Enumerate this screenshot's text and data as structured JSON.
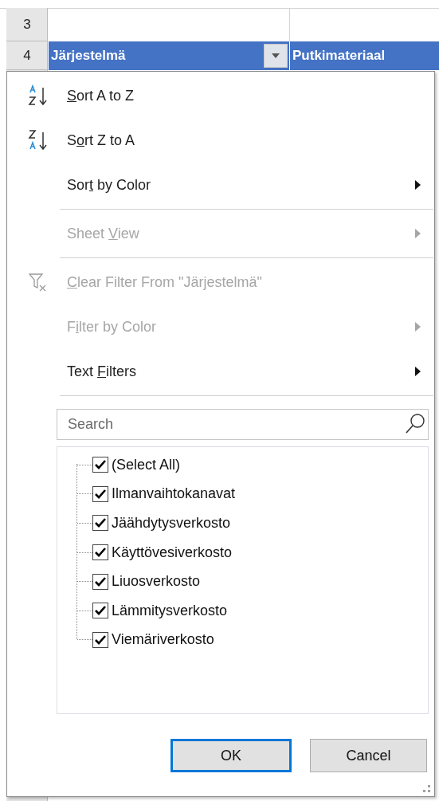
{
  "sheet": {
    "rows": [
      {
        "number": "3",
        "cells": []
      },
      {
        "number": "4",
        "cells": [
          {
            "text": "Järjestelmä",
            "filter_button": true
          },
          {
            "text": "Putkimateriaal",
            "filter_button": false
          }
        ]
      }
    ]
  },
  "menu": {
    "items": [
      {
        "kind": "sort_az",
        "label": {
          "key": "S",
          "after": "ort A to Z"
        },
        "disabled": false,
        "submenu": false,
        "divider_after": false
      },
      {
        "kind": "sort_za",
        "label": {
          "before": "S",
          "key": "o",
          "after": "rt Z to A"
        },
        "disabled": false,
        "submenu": false,
        "divider_after": false
      },
      {
        "kind": "plain",
        "label": {
          "before": "Sor",
          "key": "t",
          "after": " by Color"
        },
        "disabled": false,
        "submenu": true,
        "divider_after": true
      },
      {
        "kind": "plain",
        "label": {
          "before": "Sheet ",
          "key": "V",
          "after": "iew"
        },
        "disabled": true,
        "submenu": true,
        "divider_after": true
      },
      {
        "kind": "clear_filter",
        "label": {
          "key": "C",
          "after": "lear Filter From \"Järjestelmä\""
        },
        "disabled": true,
        "submenu": false,
        "divider_after": false
      },
      {
        "kind": "plain",
        "label": {
          "before": "F",
          "key": "i",
          "after": "lter by Color"
        },
        "disabled": true,
        "submenu": true,
        "divider_after": false
      },
      {
        "kind": "plain",
        "label": {
          "before": "Text ",
          "key": "F",
          "after": "ilters"
        },
        "disabled": false,
        "submenu": true,
        "divider_after": true
      }
    ],
    "search": {
      "placeholder": "Search"
    },
    "values": [
      {
        "label": "(Select All)",
        "checked": true
      },
      {
        "label": "Ilmanvaihtokanavat",
        "checked": true
      },
      {
        "label": "Jäähdytysverkosto",
        "checked": true
      },
      {
        "label": "Käyttövesiverkosto",
        "checked": true
      },
      {
        "label": "Liuosverkosto",
        "checked": true
      },
      {
        "label": "Lämmitysverkosto",
        "checked": true
      },
      {
        "label": "Viemäriverkosto",
        "checked": true
      }
    ],
    "buttons": [
      {
        "label": "OK",
        "default": true
      },
      {
        "label": "Cancel",
        "default": false
      }
    ]
  }
}
